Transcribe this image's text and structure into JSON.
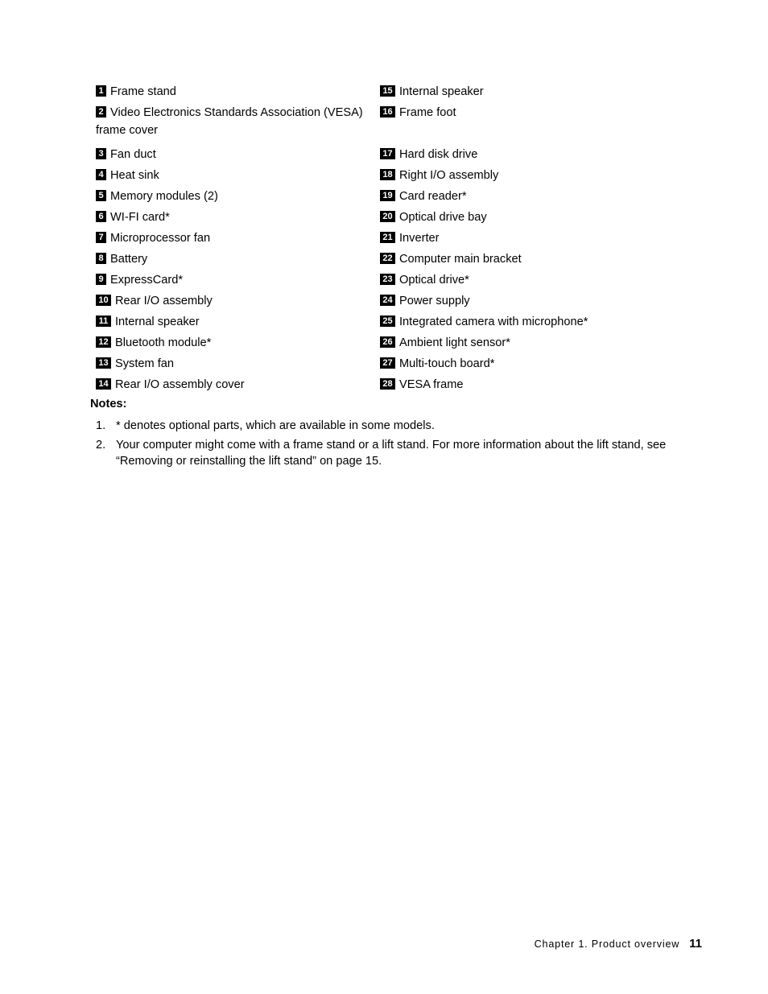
{
  "document": {
    "background_color": "#ffffff",
    "text_color": "#000000",
    "badge_color": "#000000",
    "badge_text_color": "#ffffff"
  },
  "legend": {
    "left_column": [
      {
        "number": "1",
        "label": "Frame stand"
      },
      {
        "number": "2",
        "label": "Video Electronics Standards Association (VESA) frame cover"
      },
      {
        "number": "3",
        "label": "Fan duct"
      },
      {
        "number": "4",
        "label": "Heat sink"
      },
      {
        "number": "5",
        "label": "Memory modules (2)"
      },
      {
        "number": "6",
        "label": "WI-FI card*"
      },
      {
        "number": "7",
        "label": "Microprocessor fan"
      },
      {
        "number": "8",
        "label": "Battery"
      },
      {
        "number": "9",
        "label": "ExpressCard*"
      },
      {
        "number": "10",
        "label": "Rear I/O assembly"
      },
      {
        "number": "11",
        "label": "Internal speaker"
      },
      {
        "number": "12",
        "label": "Bluetooth module*"
      },
      {
        "number": "13",
        "label": "System fan"
      },
      {
        "number": "14",
        "label": "Rear I/O assembly cover"
      }
    ],
    "right_column": [
      {
        "number": "15",
        "label": "Internal speaker"
      },
      {
        "number": "16",
        "label": "Frame foot"
      },
      {
        "number": "17",
        "label": "Hard disk drive"
      },
      {
        "number": "18",
        "label": "Right I/O assembly"
      },
      {
        "number": "19",
        "label": "Card reader*"
      },
      {
        "number": "20",
        "label": "Optical drive bay"
      },
      {
        "number": "21",
        "label": "Inverter"
      },
      {
        "number": "22",
        "label": "Computer main bracket"
      },
      {
        "number": "23",
        "label": "Optical drive*"
      },
      {
        "number": "24",
        "label": "Power supply"
      },
      {
        "number": "25",
        "label": "Integrated camera with microphone*"
      },
      {
        "number": "26",
        "label": "Ambient light sensor*"
      },
      {
        "number": "27",
        "label": "Multi-touch board*"
      },
      {
        "number": "28",
        "label": "VESA frame"
      }
    ]
  },
  "notes": {
    "heading": "Notes:",
    "items": [
      {
        "marker": "1.",
        "text": "* denotes optional parts, which are available in some models."
      },
      {
        "marker": "2.",
        "text": "Your computer might come with a frame stand or a lift stand. For more information about the lift stand, see “Removing or reinstalling the lift stand” on page 15."
      }
    ]
  },
  "footer": {
    "chapter": "Chapter 1. Product overview",
    "page_number": "11"
  }
}
